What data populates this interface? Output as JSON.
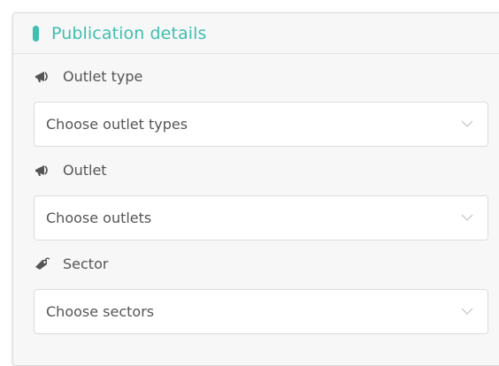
{
  "panel": {
    "title": "Publication details",
    "accent_color": "#3fbfb0"
  },
  "fields": [
    {
      "label": "Outlet type",
      "icon": "megaphone-icon",
      "placeholder": "Choose outlet types"
    },
    {
      "label": "Outlet",
      "icon": "megaphone-icon",
      "placeholder": "Choose outlets"
    },
    {
      "label": "Sector",
      "icon": "tag-icon",
      "placeholder": "Choose sectors"
    }
  ]
}
